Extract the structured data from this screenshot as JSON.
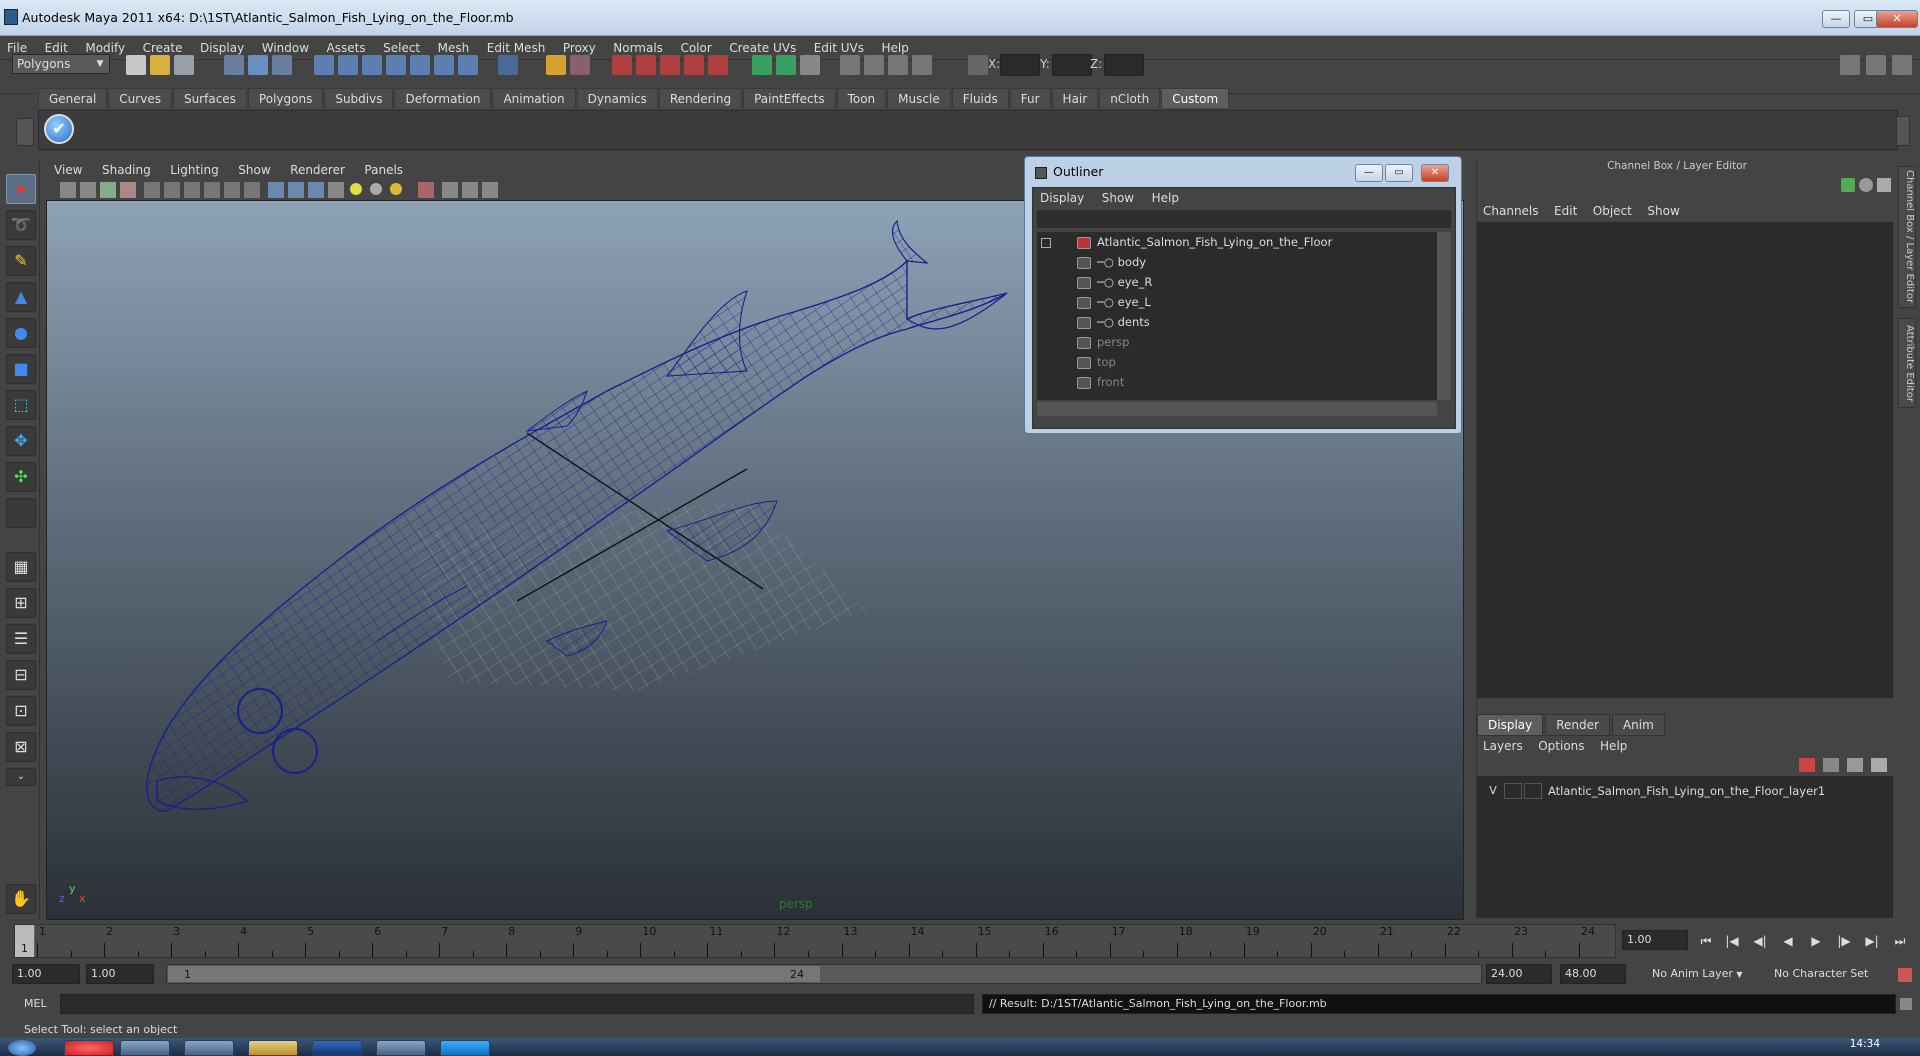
{
  "window": {
    "title": "Autodesk Maya 2011 x64: D:\\1ST\\Atlantic_Salmon_Fish_Lying_on_the_Floor.mb",
    "min": "—",
    "max": "▭",
    "close": "✕"
  },
  "menubar": [
    "File",
    "Edit",
    "Modify",
    "Create",
    "Display",
    "Window",
    "Assets",
    "Select",
    "Mesh",
    "Edit Mesh",
    "Proxy",
    "Normals",
    "Color",
    "Create UVs",
    "Edit UVs",
    "Help"
  ],
  "statusline": {
    "menuset": "Polygons",
    "x_label": "X:",
    "y_label": "Y:",
    "z_label": "Z:"
  },
  "shelf": {
    "tabs": [
      "General",
      "Curves",
      "Surfaces",
      "Polygons",
      "Subdivs",
      "Deformation",
      "Animation",
      "Dynamics",
      "Rendering",
      "PaintEffects",
      "Toon",
      "Muscle",
      "Fluids",
      "Fur",
      "Hair",
      "nCloth",
      "Custom"
    ],
    "active_tab": "Custom",
    "button_glyph": "✔"
  },
  "viewport": {
    "menu": [
      "View",
      "Shading",
      "Lighting",
      "Show",
      "Renderer",
      "Panels"
    ],
    "camera_label": "persp",
    "axis_y": "y",
    "axis_x": "x",
    "axis_z": "z"
  },
  "outliner": {
    "title": "Outliner",
    "menu": [
      "Display",
      "Show",
      "Help"
    ],
    "root": "Atlantic_Salmon_Fish_Lying_on_the_Floor",
    "children": [
      "body",
      "eye_R",
      "eye_L",
      "dents"
    ],
    "cameras": [
      "persp",
      "top",
      "front"
    ]
  },
  "channelbox": {
    "title": "Channel Box / Layer Editor",
    "menu": [
      "Channels",
      "Edit",
      "Object",
      "Show"
    ]
  },
  "layer_editor": {
    "tabs": [
      "Display",
      "Render",
      "Anim"
    ],
    "active_tab": "Display",
    "menu": [
      "Layers",
      "Options",
      "Help"
    ],
    "layer_visibility": "V",
    "layer_name": "Atlantic_Salmon_Fish_Lying_on_the_Floor_layer1"
  },
  "side_tabs": {
    "channel_box": "Channel Box / Layer Editor",
    "attribute_editor": "Attribute Editor"
  },
  "timeline": {
    "ticks": [
      "1",
      "2",
      "3",
      "4",
      "5",
      "6",
      "7",
      "8",
      "9",
      "10",
      "11",
      "12",
      "13",
      "14",
      "15",
      "16",
      "17",
      "18",
      "19",
      "20",
      "21",
      "22",
      "23",
      "24"
    ],
    "current_frame": "1",
    "current_time": "1.00"
  },
  "playback": {
    "buttons": [
      "⏮",
      "|◀",
      "◀|",
      "◀",
      "▶",
      "|▶",
      "▶|",
      "⏭"
    ]
  },
  "range": {
    "start": "1.00",
    "playback_start": "1.00",
    "slider_start": "1",
    "slider_end": "24",
    "playback_end": "24.00",
    "end": "48.00",
    "anim_layer": "No Anim Layer",
    "character_set": "No Character Set"
  },
  "command": {
    "mel_label": "MEL",
    "result": "// Result: D:/1ST/Atlantic_Salmon_Fish_Lying_on_the_Floor.mb"
  },
  "helpline": "Select Tool: select an object",
  "taskbar": {
    "clock": "14:34"
  }
}
